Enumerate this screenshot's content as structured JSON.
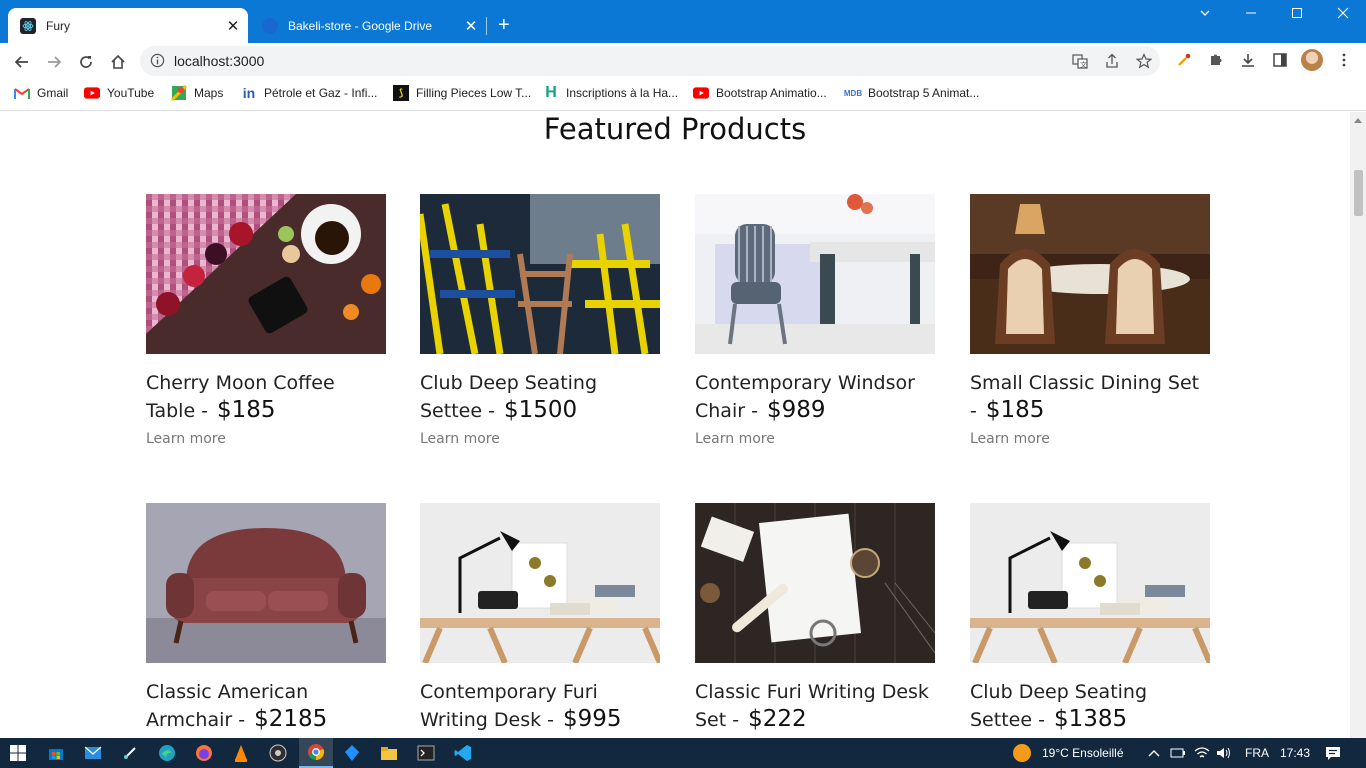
{
  "browser": {
    "tabs": [
      {
        "title": "Fury",
        "active": true
      },
      {
        "title": "Bakeli-store - Google Drive",
        "active": false
      }
    ],
    "close_glyph": "✕",
    "new_tab_glyph": "+",
    "address": "localhost:3000",
    "bookmarks": [
      {
        "label": "Gmail",
        "icon": "gmail-icon"
      },
      {
        "label": "YouTube",
        "icon": "youtube-icon"
      },
      {
        "label": "Maps",
        "icon": "maps-icon"
      },
      {
        "label": "Pétrole et Gaz - Infi...",
        "icon": "linkedin-icon"
      },
      {
        "label": "Filling Pieces Low T...",
        "icon": "filling-pieces-icon"
      },
      {
        "label": "Inscriptions à la Ha...",
        "icon": "h-icon"
      },
      {
        "label": "Bootstrap Animatio...",
        "icon": "youtube-icon"
      },
      {
        "label": "Bootstrap 5 Animat...",
        "icon": "mdb-icon"
      }
    ]
  },
  "page": {
    "heading": "Featured Products",
    "learn_more": "Learn more",
    "products": [
      {
        "name": "Cherry Moon Coffee Table -",
        "price": "$185",
        "image": "coffee-table-photo"
      },
      {
        "name": "Club Deep Seating Settee -",
        "price": "$1500",
        "image": "yellow-chairs-photo"
      },
      {
        "name": "Contemporary Windsor Chair -",
        "price": "$989",
        "image": "windsor-chair-photo"
      },
      {
        "name": "Small Classic Dining Set -",
        "price": "$185",
        "image": "dining-set-photo"
      },
      {
        "name": "Classic American Armchair -",
        "price": "$2185",
        "image": "leather-sofa-photo"
      },
      {
        "name": "Contemporary Furi Writing Desk -",
        "price": "$995",
        "image": "writing-desk-photo"
      },
      {
        "name": "Classic Furi Writing Desk Set -",
        "price": "$222",
        "image": "desk-set-photo"
      },
      {
        "name": "Club Deep Seating Settee -",
        "price": "$1385",
        "image": "writing-desk-photo"
      }
    ]
  },
  "taskbar": {
    "weather": "19°C  Ensoleillé",
    "language": "FRA",
    "time": "17:43"
  },
  "colors": {
    "title_bar": "#0b78d6",
    "taskbar": "#12283f",
    "price_text": "#111111",
    "learn_more_text": "#777777"
  }
}
